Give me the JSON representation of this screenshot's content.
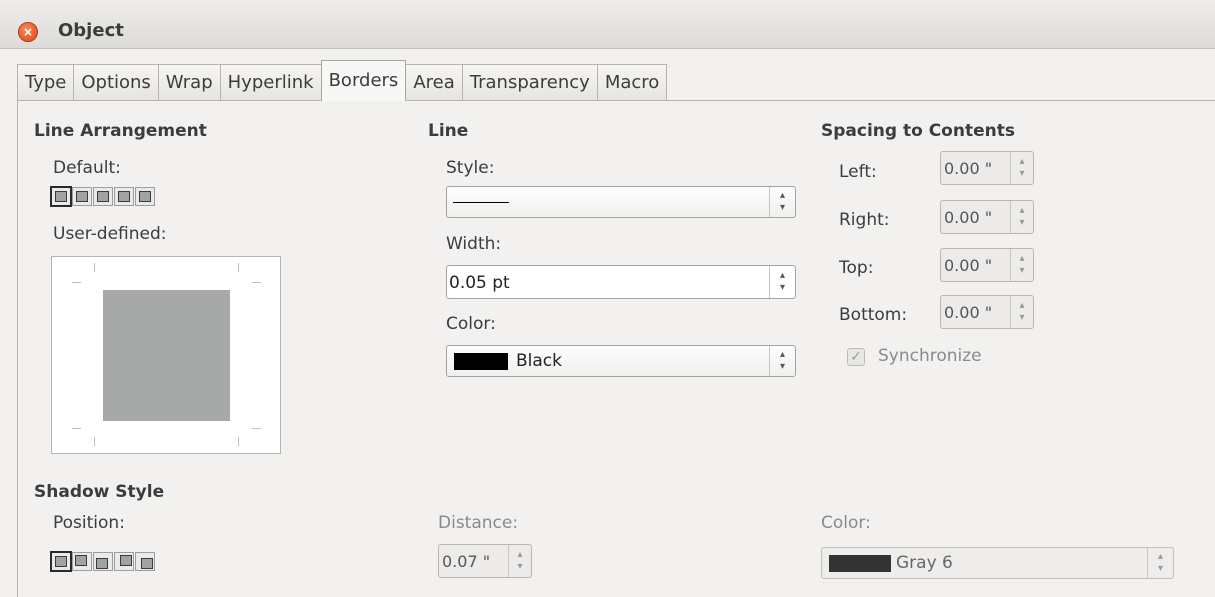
{
  "window": {
    "title": "Object"
  },
  "tabs": [
    "Type",
    "Options",
    "Wrap",
    "Hyperlink",
    "Borders",
    "Area",
    "Transparency",
    "Macro"
  ],
  "active_tab": "Borders",
  "line_arrangement": {
    "heading": "Line Arrangement",
    "default_label": "Default:",
    "user_defined_label": "User-defined:"
  },
  "line": {
    "heading": "Line",
    "style_label": "Style:",
    "width_label": "Width:",
    "width_value": "0.05 pt",
    "color_label": "Color:",
    "color_value": "Black",
    "color_swatch": "#000000"
  },
  "spacing": {
    "heading": "Spacing to Contents",
    "left_label": "Left:",
    "left_value": "0.00 \"",
    "right_label": "Right:",
    "right_value": "0.00 \"",
    "top_label": "Top:",
    "top_value": "0.00 \"",
    "bottom_label": "Bottom:",
    "bottom_value": "0.00 \"",
    "synchronize_label": "Synchronize",
    "synchronize_checked": true
  },
  "shadow": {
    "heading": "Shadow Style",
    "position_label": "Position:",
    "distance_label": "Distance:",
    "distance_value": "0.07 \"",
    "color_label": "Color:",
    "color_value": "Gray 6",
    "color_swatch": "#333333"
  }
}
